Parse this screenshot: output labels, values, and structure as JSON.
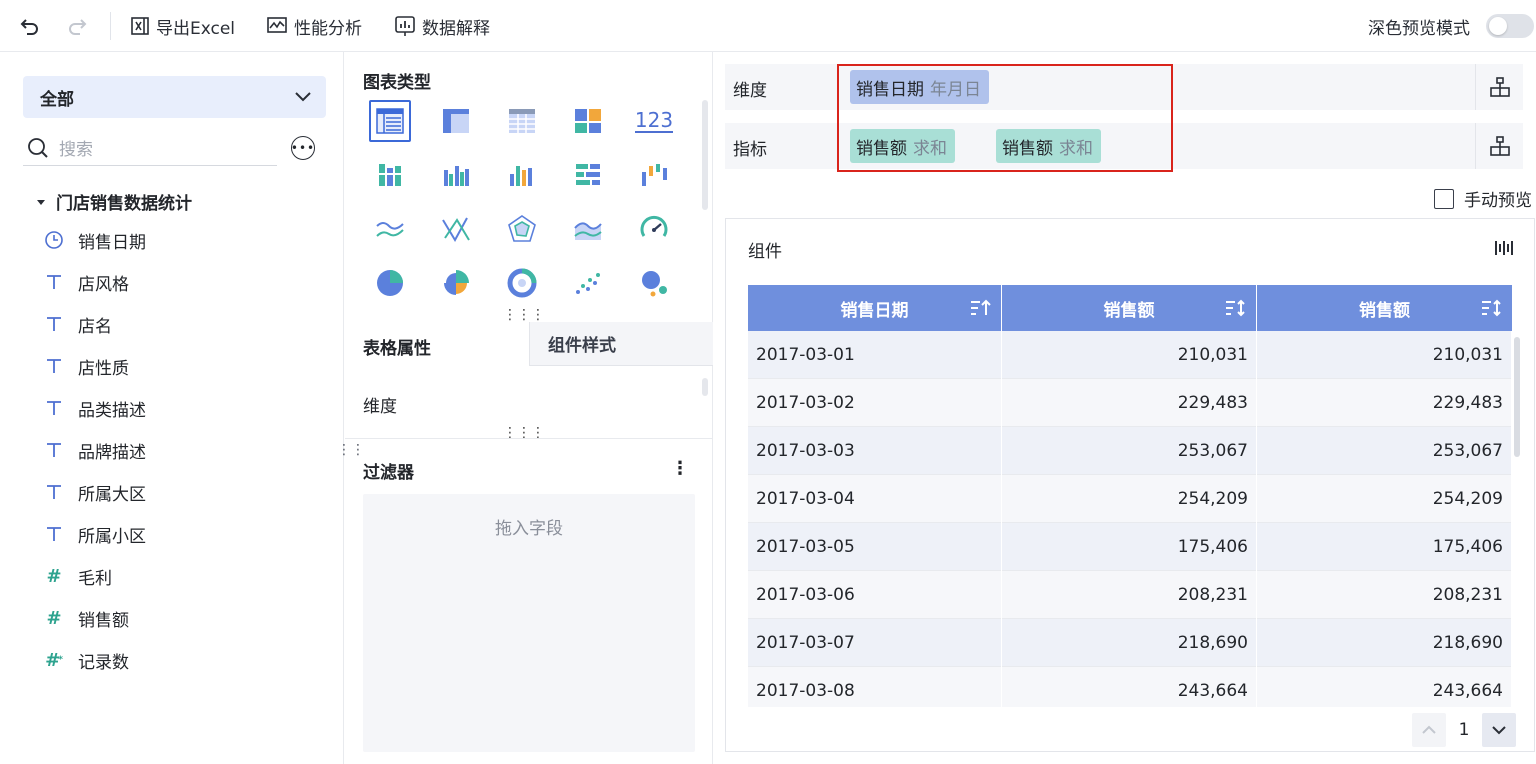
{
  "toolbar": {
    "export_label": "导出Excel",
    "perf_label": "性能分析",
    "explain_label": "数据解释",
    "dark_mode_label": "深色预览模式"
  },
  "left": {
    "table_select": "全部",
    "search_placeholder": "搜索",
    "dataset_name": "门店销售数据统计",
    "fields": [
      {
        "label": "销售日期",
        "type": "date"
      },
      {
        "label": "店风格",
        "type": "text"
      },
      {
        "label": "店名",
        "type": "text"
      },
      {
        "label": "店性质",
        "type": "text"
      },
      {
        "label": "品类描述",
        "type": "text"
      },
      {
        "label": "品牌描述",
        "type": "text"
      },
      {
        "label": "所属大区",
        "type": "text"
      },
      {
        "label": "所属小区",
        "type": "text"
      },
      {
        "label": "毛利",
        "type": "number"
      },
      {
        "label": "销售额",
        "type": "number"
      },
      {
        "label": "记录数",
        "type": "number-star"
      }
    ]
  },
  "middle": {
    "chart_type_title": "图表类型",
    "tab_table_props": "表格属性",
    "tab_component_style": "组件样式",
    "dimension_label": "维度",
    "filter_title": "过滤器",
    "drop_hint": "拖入字段",
    "number_card_label": "123"
  },
  "right": {
    "dim_shelf_label": "维度",
    "measure_shelf_label": "指标",
    "dim_pill": {
      "name": "销售日期",
      "agg": "年月日"
    },
    "measure_pills": [
      {
        "name": "销售额",
        "agg": "求和"
      },
      {
        "name": "销售额",
        "agg": "求和"
      }
    ],
    "manual_preview_label": "手动预览",
    "component_title": "组件",
    "table": {
      "headers": [
        "销售日期",
        "销售额",
        "销售额"
      ],
      "rows": [
        [
          "2017-03-01",
          "210,031",
          "210,031"
        ],
        [
          "2017-03-02",
          "229,483",
          "229,483"
        ],
        [
          "2017-03-03",
          "253,067",
          "253,067"
        ],
        [
          "2017-03-04",
          "254,209",
          "254,209"
        ],
        [
          "2017-03-05",
          "175,406",
          "175,406"
        ],
        [
          "2017-03-06",
          "208,231",
          "208,231"
        ],
        [
          "2017-03-07",
          "218,690",
          "218,690"
        ],
        [
          "2017-03-08",
          "243,664",
          "243,664"
        ]
      ]
    },
    "page_number": "1"
  },
  "colors": {
    "header_blue": "#6f8fdd",
    "dim_pill": "#b0c2ec",
    "measure_pill": "#a9dfd6",
    "highlight_red": "#d9241c"
  }
}
